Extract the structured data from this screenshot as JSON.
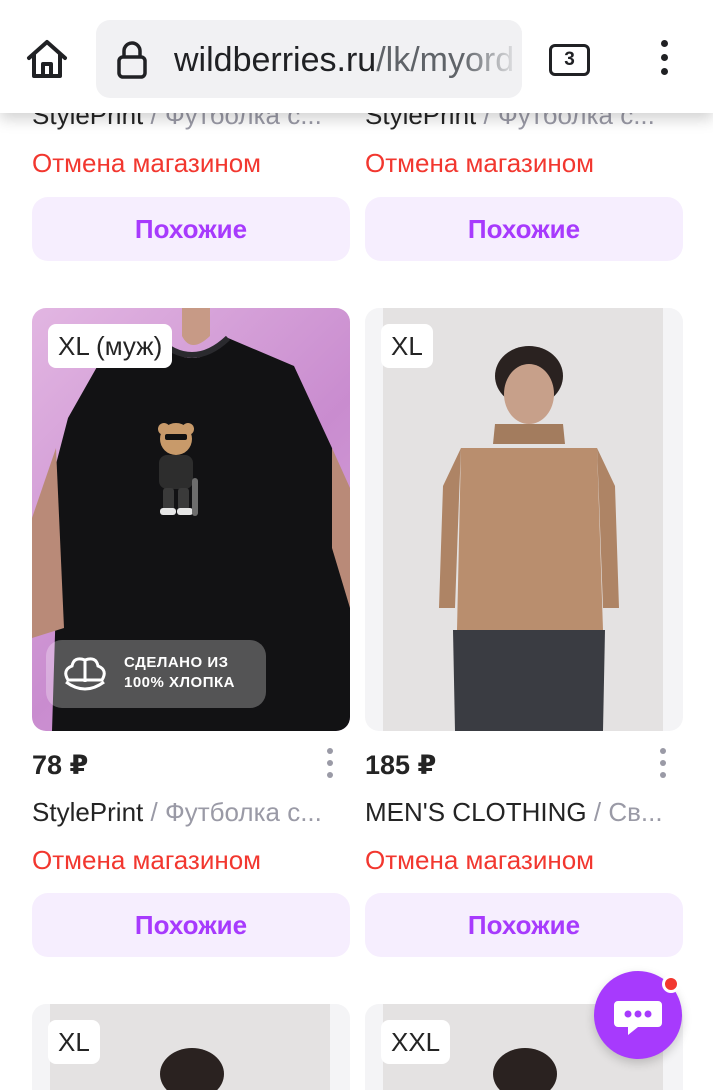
{
  "browser": {
    "url_domain": "wildberries.ru",
    "url_path": "/lk/myord",
    "tab_count": "3"
  },
  "top_partial": [
    {
      "brand": "StylePrint",
      "separator": " / ",
      "name": "Футболка с...",
      "status": "Отмена магазином",
      "similar_label": "Похожие"
    },
    {
      "brand": "StylePrint",
      "separator": " / ",
      "name": "Футболка с...",
      "status": "Отмена магазином",
      "similar_label": "Похожие"
    }
  ],
  "products": [
    {
      "size": "XL (муж)",
      "price": "78 ₽",
      "brand": "StylePrint",
      "separator": " / ",
      "name": "Футболка с...",
      "status": "Отмена магазином",
      "similar_label": "Похожие",
      "cotton_badge": [
        "СДЕЛАНО ИЗ",
        "100% ХЛОПКА"
      ]
    },
    {
      "size": "XL",
      "price": "185 ₽",
      "brand": "MEN'S CLOTHING",
      "separator": " / ",
      "name": "Св...",
      "status": "Отмена магазином",
      "similar_label": "Похожие"
    }
  ],
  "bottom_partial": [
    {
      "size": "XL"
    },
    {
      "size": "XXL"
    }
  ],
  "colors": {
    "accent": "#a73afd",
    "cancel_status": "#f2372f",
    "button_bg": "#f6eefe"
  },
  "icons": {
    "home": "home-icon",
    "lock": "lock-icon",
    "menu": "more-vert-icon",
    "chat": "chat-icon",
    "kebab": "more-vert-icon",
    "cotton": "cotton-icon"
  }
}
